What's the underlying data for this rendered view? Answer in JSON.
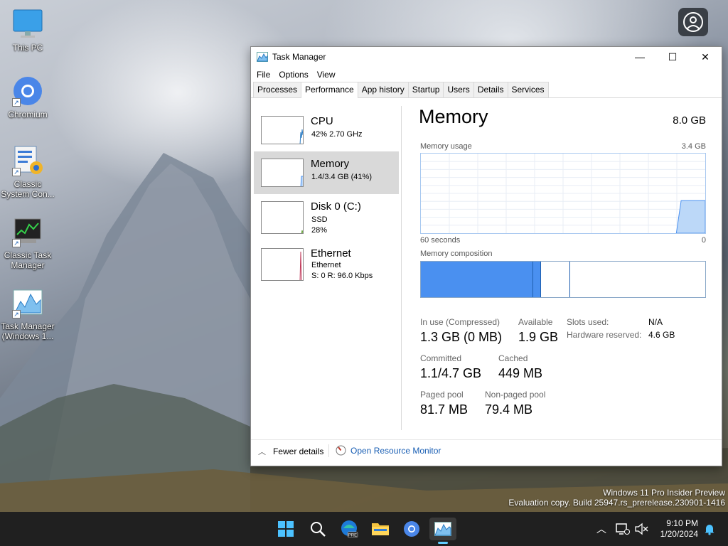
{
  "desktop": {
    "icons": [
      {
        "label": "This PC",
        "icon": "monitor-icon"
      },
      {
        "label": "Chromium",
        "icon": "chromium-icon"
      },
      {
        "label": "Classic System Con...",
        "label2": "",
        "icon": "control-panel-icon"
      },
      {
        "label": "Classic Task",
        "label2": "Manager",
        "icon": "classic-task-manager-icon"
      },
      {
        "label": "Task Manager",
        "label2": "(Windows 1...",
        "icon": "task-manager-icon"
      }
    ],
    "watermark": {
      "line1": "Windows 11 Pro Insider Preview",
      "line2": "Evaluation copy. Build 25947.rs_prerelease.230901-1416"
    }
  },
  "window": {
    "title": "Task Manager",
    "menu": [
      "File",
      "Options",
      "View"
    ],
    "tabs": [
      "Processes",
      "Performance",
      "App history",
      "Startup",
      "Users",
      "Details",
      "Services"
    ],
    "active_tab": "Performance"
  },
  "sidebar": {
    "items": [
      {
        "name": "CPU",
        "line1": "42%  2.70 GHz",
        "line2": ""
      },
      {
        "name": "Memory",
        "line1": "1.4/3.4 GB (41%)",
        "line2": ""
      },
      {
        "name": "Disk 0 (C:)",
        "line1": "SSD",
        "line2": "28%"
      },
      {
        "name": "Ethernet",
        "line1": "Ethernet",
        "line2": "S: 0  R: 96.0 Kbps"
      }
    ]
  },
  "memory": {
    "title": "Memory",
    "total": "8.0 GB",
    "usage_label": "Memory usage",
    "usage_max": "3.4 GB",
    "time_left": "60 seconds",
    "time_right": "0",
    "composition_label": "Memory composition",
    "usage_history": [
      0,
      0,
      0,
      0,
      0,
      0,
      0,
      0,
      0,
      0,
      0,
      0,
      0,
      0,
      0,
      0,
      0,
      0,
      0,
      0,
      0,
      0,
      0,
      0,
      0,
      0,
      0,
      0,
      0,
      0,
      0,
      0,
      0,
      0,
      0,
      0,
      0,
      0,
      0,
      0,
      0,
      0,
      0,
      0,
      0,
      0,
      0,
      0,
      0,
      0,
      0,
      0,
      0,
      0,
      0.41,
      0.41,
      0.41,
      0.41,
      0.41,
      0.41
    ],
    "composition": {
      "in_use_fraction": 0.395,
      "modified_fraction": 0.027,
      "standby_fraction": 0.104
    },
    "stats": {
      "in_use_label": "In use (Compressed)",
      "in_use_value": "1.3 GB (0 MB)",
      "available_label": "Available",
      "available_value": "1.9 GB",
      "slots_label": "Slots used:",
      "slots_value": "N/A",
      "hw_reserved_label": "Hardware reserved:",
      "hw_reserved_value": "4.6 GB",
      "committed_label": "Committed",
      "committed_value": "1.1/4.7 GB",
      "cached_label": "Cached",
      "cached_value": "449 MB",
      "paged_label": "Paged pool",
      "paged_value": "81.7 MB",
      "nonpaged_label": "Non-paged pool",
      "nonpaged_value": "79.4 MB"
    }
  },
  "footer": {
    "fewer_details": "Fewer details",
    "open_resmon": "Open Resource Monitor"
  },
  "taskbar": {
    "time": "9:10 PM",
    "date": "1/20/2024"
  },
  "colors": {
    "accent": "#4a90f0",
    "graph_fill": "#bcd8f8",
    "graph_line": "#4a90f0",
    "link": "#1a5fb4"
  }
}
